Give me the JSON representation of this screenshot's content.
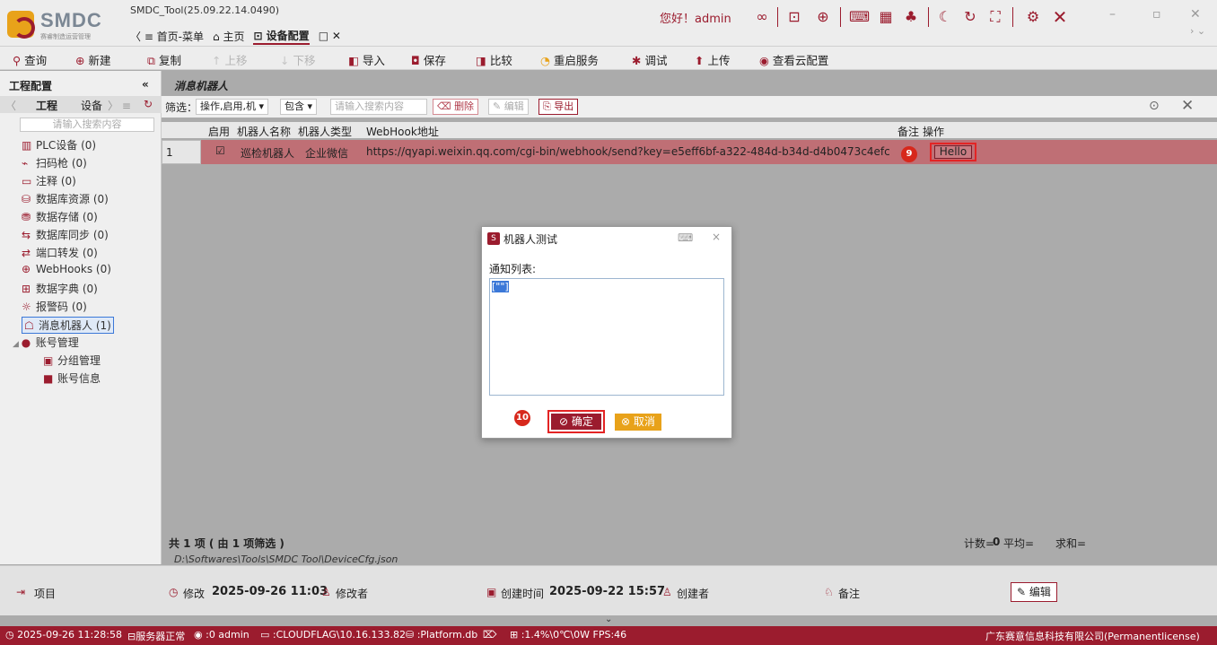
{
  "app": {
    "title": "SMDC_Tool(25.09.22.14.0490)",
    "brand": "SMDC",
    "brand_sub": "赛睿制造运营管理",
    "greeting": "您好！admin",
    "accent": "#9b1c2e"
  },
  "tabs": {
    "menu": "〈 ≡ 首页-菜单",
    "home": "⌂ 主页",
    "device_cfg": "⊡ 设备配置",
    "close": "□ ✕"
  },
  "toolbar": {
    "query": "查询",
    "new": "新建",
    "copy": "复制",
    "up": "上移",
    "down": "下移",
    "import": "导入",
    "save": "保存",
    "compare": "比较",
    "restart": "重启服务",
    "debug": "调试",
    "upload": "上传",
    "cloud": "查看云配置"
  },
  "sidebar": {
    "header": "工程配置",
    "collapse": "«",
    "tab_project": "工程",
    "tab_device": "设备",
    "search_placeholder": "请输入搜索内容",
    "items": [
      {
        "icon": "plc-icon",
        "glyph": "▥",
        "label": "PLC设备 (0)"
      },
      {
        "icon": "scanner-icon",
        "glyph": "⌁",
        "label": "扫码枪 (0)"
      },
      {
        "icon": "comment-icon",
        "glyph": "▭",
        "label": "注释 (0)"
      },
      {
        "icon": "database-icon",
        "glyph": "⛁",
        "label": "数据库资源 (0)"
      },
      {
        "icon": "storage-icon",
        "glyph": "⛃",
        "label": "数据存储 (0)"
      },
      {
        "icon": "sync-icon",
        "glyph": "⇆",
        "label": "数据库同步 (0)"
      },
      {
        "icon": "port-icon",
        "glyph": "⇄",
        "label": "端口转发 (0)"
      },
      {
        "icon": "globe-icon",
        "glyph": "⊕",
        "label": "WebHooks (0)"
      },
      {
        "icon": "dictionary-icon",
        "glyph": "⊞",
        "label": "数据字典 (0)"
      },
      {
        "icon": "alarm-icon",
        "glyph": "☼",
        "label": "报警码 (0)"
      },
      {
        "icon": "robot-icon",
        "glyph": "☖",
        "label": "消息机器人 (1)"
      }
    ],
    "account": "账号管理",
    "account_items": [
      "分组管理",
      "账号信息"
    ]
  },
  "content": {
    "title": "消息机器人",
    "filter_label": "筛选：",
    "filter_value": "操作,启用,机 ▾",
    "filter_mode": "包含 ▾",
    "search_placeholder": "请输入搜索内容",
    "btn_delete": "删除",
    "btn_edit": "编辑",
    "btn_export": "导出",
    "columns": [
      "启用",
      "机器人名称",
      "机器人类型",
      "WebHook地址",
      "备注",
      "操作"
    ],
    "row": {
      "index": "1",
      "enabled": "☑",
      "name": "巡检机器人",
      "type": "企业微信",
      "url": "https://qyapi.weixin.qq.com/cgi-bin/webhook/send?key=e5eff6bf-a322-484d-b34d-d4b0473c4efc",
      "note": "",
      "action": "Hello"
    },
    "summary": "共 1 项 ( 由 1 项筛选 )",
    "stats": {
      "count_label": "计数=",
      "count": "0",
      "avg_label": "平均=",
      "sum_label": "求和="
    },
    "path": "D:\\Softwares\\Tools\\SMDC Tool\\DeviceCfg.json"
  },
  "infobar": {
    "project_label": "项目",
    "modified_label": "修改",
    "modified_time": "2025-09-26 11:03",
    "modifier_label": "修改者",
    "created_label": "创建时间",
    "created_time": "2025-09-22 15:57",
    "creator_label": "创建者",
    "note_label": "备注",
    "edit_btn": "编辑"
  },
  "statusbar": {
    "time": "2025-09-26 11:28:58",
    "server": "服务器正常",
    "user": ":0 admin",
    "host": ":CLOUDFLAG\\10.16.133.82",
    "db": ":Platform.db",
    "perf": ":1.4%\\0℃\\0W FPS:46",
    "company": "广东赛意信息科技有限公司(Permanentlicense)"
  },
  "dialog": {
    "title": "机器人测试",
    "list_label": "通知列表:",
    "list_value": "[\"\"]",
    "ok": "确定",
    "cancel": "取消"
  },
  "annotations": {
    "badge9": "9",
    "badge10": "10"
  }
}
